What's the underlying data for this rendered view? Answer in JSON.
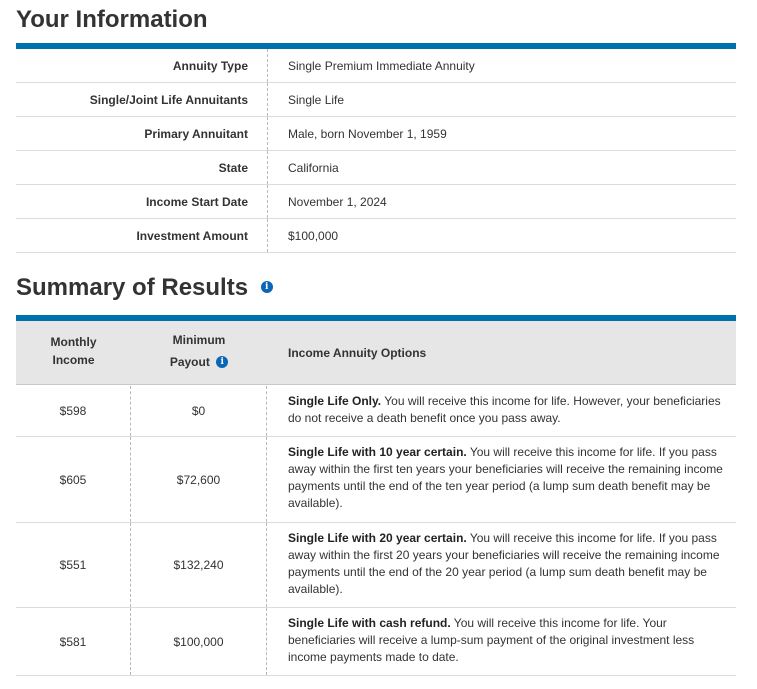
{
  "your_information": {
    "title": "Your Information",
    "rows": [
      {
        "label": "Annuity Type",
        "value": "Single Premium Immediate Annuity"
      },
      {
        "label": "Single/Joint Life Annuitants",
        "value": "Single Life"
      },
      {
        "label": "Primary Annuitant",
        "value": "Male, born November 1, 1959"
      },
      {
        "label": "State",
        "value": "California"
      },
      {
        "label": "Income Start Date",
        "value": "November 1, 2024"
      },
      {
        "label": "Investment Amount",
        "value": "$100,000"
      }
    ]
  },
  "summary": {
    "title": "Summary of Results",
    "info_icon": "info-icon",
    "headers": {
      "monthly_line1": "Monthly",
      "monthly_line2": "Income",
      "minimum_line1": "Minimum",
      "minimum_line2": "Payout",
      "options": "Income Annuity Options"
    },
    "rows": [
      {
        "monthly": "$598",
        "minimum": "$0",
        "option_title": "Single Life Only.",
        "option_text": " You will receive this income for life. However, your beneficiaries do not receive a death benefit once you pass away."
      },
      {
        "monthly": "$605",
        "minimum": "$72,600",
        "option_title": "Single Life with 10 year certain.",
        "option_text": " You will receive this income for life. If you pass away within the first ten years your beneficiaries will receive the remaining income payments until the end of the ten year period (a lump sum death benefit may be available)."
      },
      {
        "monthly": "$551",
        "minimum": "$132,240",
        "option_title": "Single Life with 20 year certain.",
        "option_text": " You will receive this income for life. If you pass away within the first 20 years your beneficiaries will receive the remaining income payments until the end of the 20 year period (a lump sum death benefit may be available)."
      },
      {
        "monthly": "$581",
        "minimum": "$100,000",
        "option_title": "Single Life with cash refund.",
        "option_text": " You will receive this income for life. Your beneficiaries will receive a lump-sum payment of the original investment less income payments made to date."
      }
    ]
  },
  "colors": {
    "accent_bar": "#0070ad",
    "info_icon": "#0a66b7",
    "header_bg": "#e6e6e6"
  }
}
